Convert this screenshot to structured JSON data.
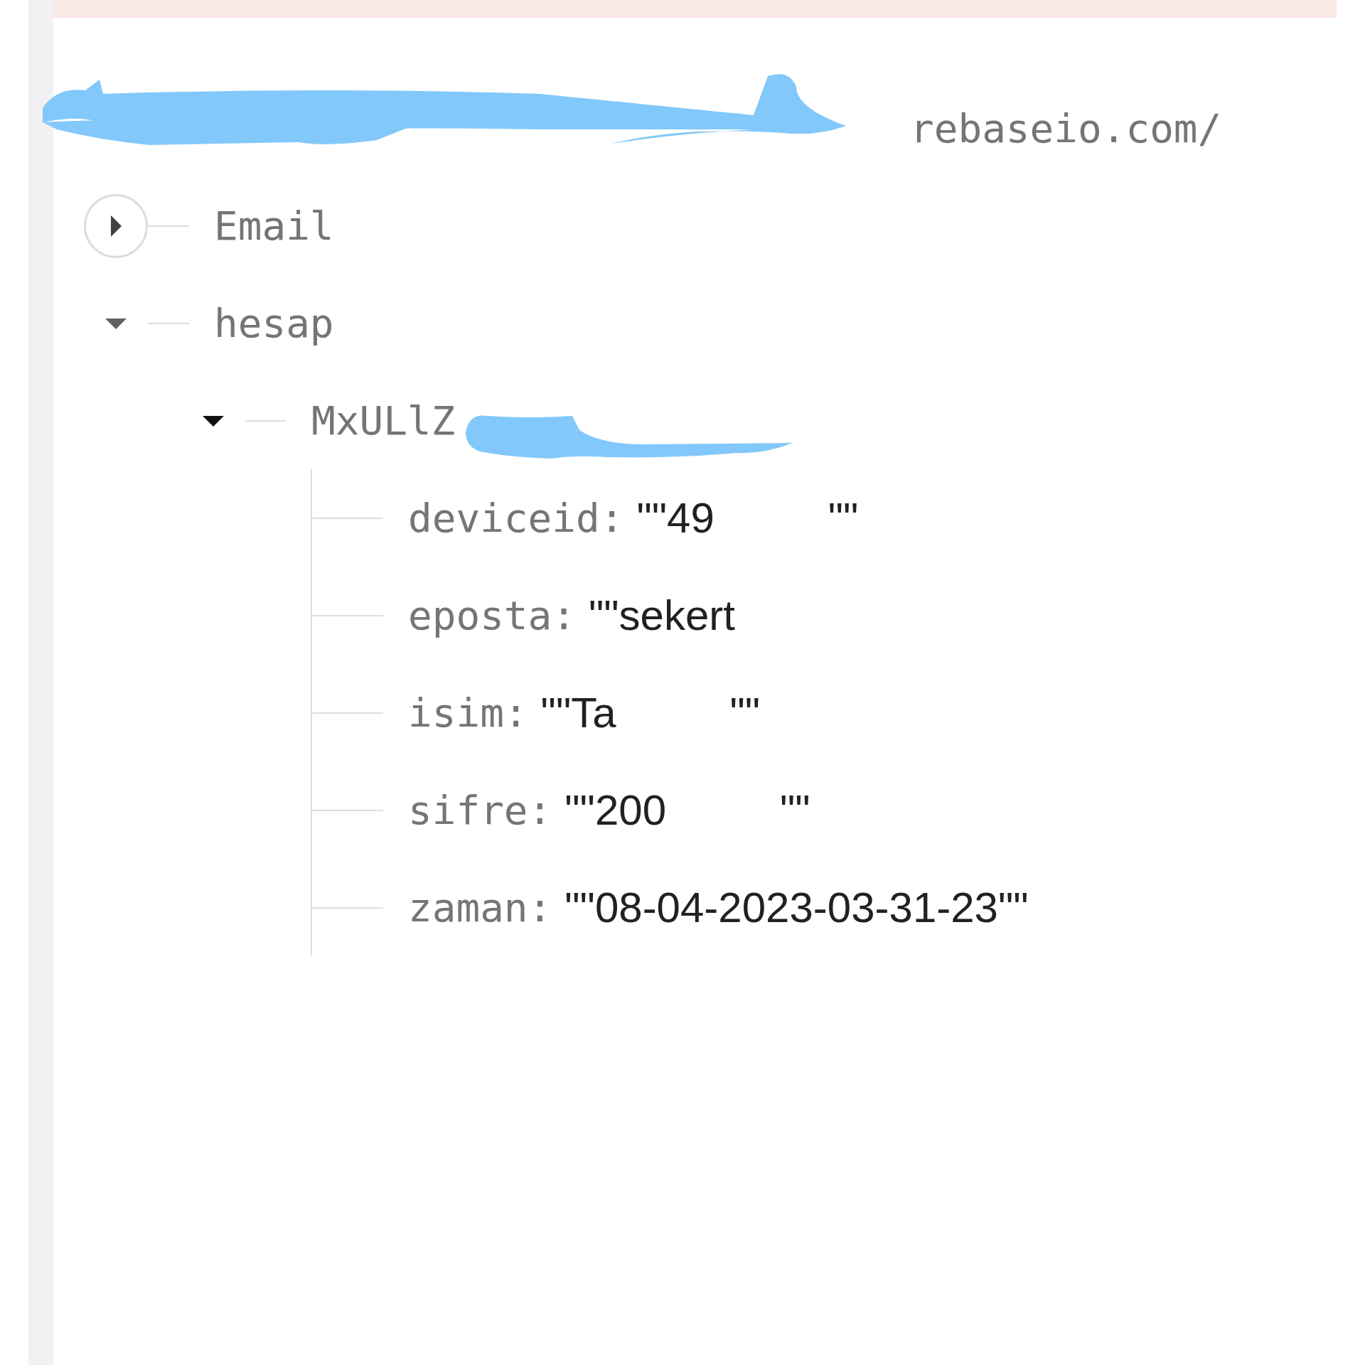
{
  "database_url": "rebaseio.com/",
  "tree": [
    {
      "key": "Email",
      "expanded": false
    },
    {
      "key": "hesap",
      "expanded": true,
      "children": [
        {
          "key": "MxULlZ",
          "expanded": true,
          "children": [
            {
              "key": "deviceid:",
              "value": "\"\"49",
              "value_end": "\"\""
            },
            {
              "key": "eposta:",
              "value": "\"\"sekert"
            },
            {
              "key": "isim:",
              "value": "\"\"Ta",
              "value_end": "\"\""
            },
            {
              "key": "sifre:",
              "value": "\"\"200",
              "value_end": "\"\""
            },
            {
              "key": "zaman:",
              "value": "\"\"08-04-2023-03-31-23\"\""
            }
          ]
        }
      ]
    }
  ]
}
